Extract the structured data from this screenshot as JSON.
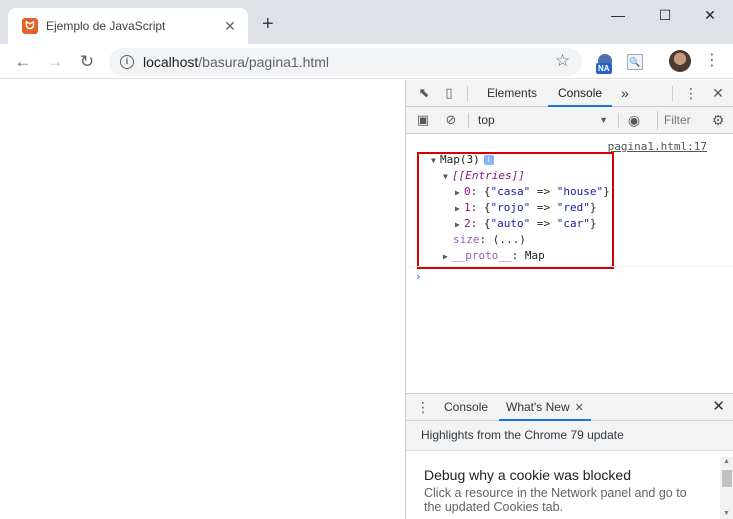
{
  "browser": {
    "tab_title": "Ejemplo de JavaScript",
    "new_tab": "+",
    "url_host": "localhost",
    "url_path": "/basura/pagina1.html",
    "ext_badge": "NA"
  },
  "devtools": {
    "tabs": [
      "Elements",
      "Console"
    ],
    "active_tab": "Console",
    "overflow": "»",
    "context": "top",
    "filter_placeholder": "Filter",
    "source_link": "pagina1.html:17",
    "log": {
      "header": "Map(3)",
      "info": "i",
      "entries_label": "[[Entries]]",
      "entries": [
        {
          "index": "0",
          "key": "\"casa\"",
          "value": "\"house\""
        },
        {
          "index": "1",
          "key": "\"rojo\"",
          "value": "\"red\""
        },
        {
          "index": "2",
          "key": "\"auto\"",
          "value": "\"car\""
        }
      ],
      "size_key": "size",
      "size_value": "(...)",
      "proto_key": "__proto__",
      "proto_value": "Map"
    },
    "drawer": {
      "tabs": [
        "Console",
        "What's New"
      ],
      "active_tab": "What's New",
      "header": "Highlights from the Chrome 79 update",
      "item_title": "Debug why a cookie was blocked",
      "item_desc": "Click a resource in the Network panel and go to the updated Cookies tab."
    }
  },
  "colors": {
    "highlight_border": "#d90000",
    "active_tab_underline": "#1a73e8",
    "favicon": "#e0622a"
  }
}
